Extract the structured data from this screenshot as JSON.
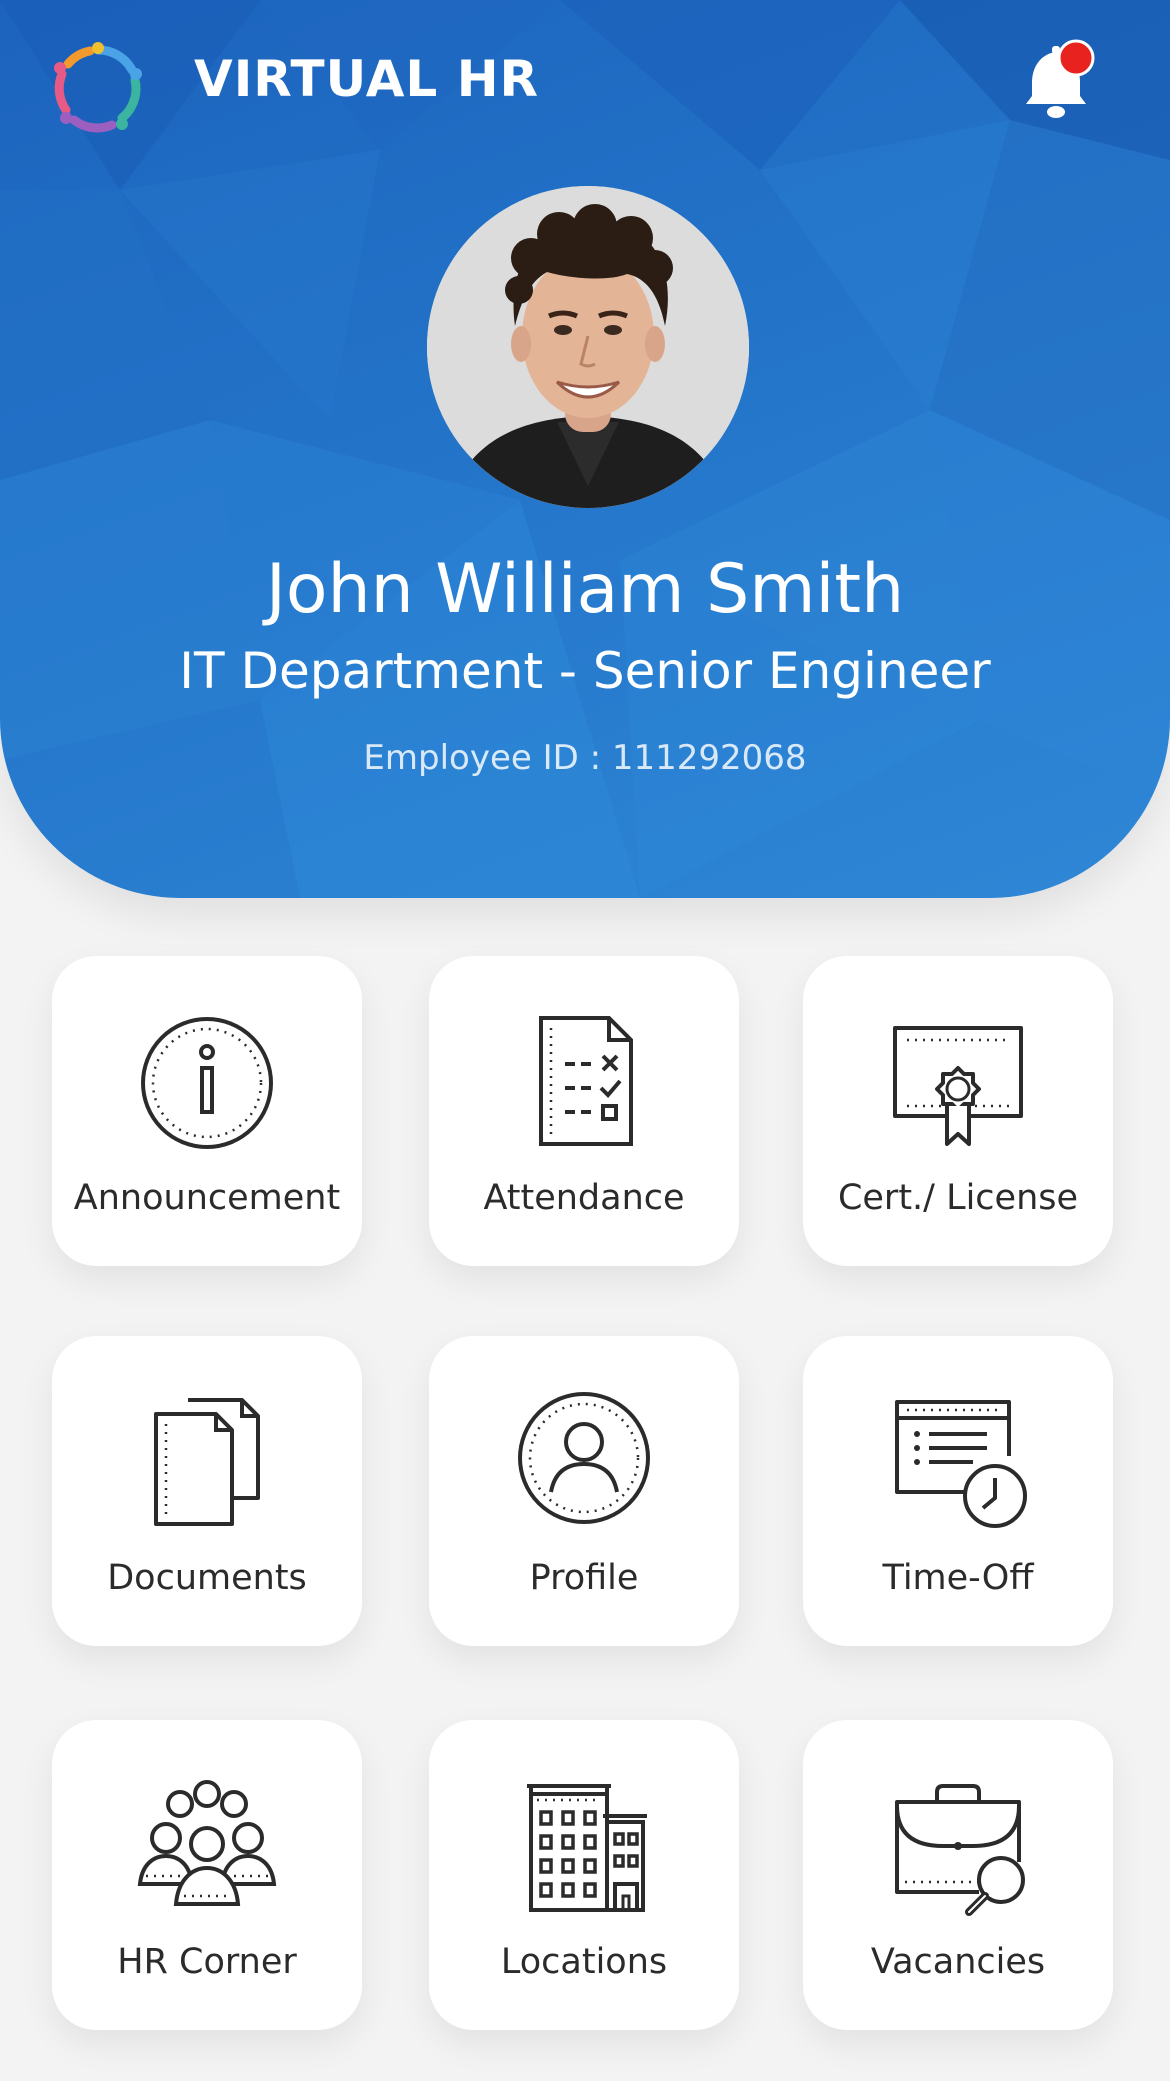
{
  "app": {
    "title": "VIRTUAL HR",
    "logo_icon": "circle-of-people-logo",
    "notification_icon": "bell-icon",
    "notification_badge_color": "#e8231f",
    "brand_color": "#2374c9"
  },
  "employee": {
    "name": "John William Smith",
    "department": "IT Department - Senior Engineer",
    "employee_id": "Employee ID : 111292068"
  },
  "menu": [
    {
      "label": "Announcement",
      "icon": "info-icon"
    },
    {
      "label": "Attendance",
      "icon": "checklist-document-icon"
    },
    {
      "label": "Cert./ License",
      "icon": "certificate-icon"
    },
    {
      "label": "Documents",
      "icon": "documents-icon"
    },
    {
      "label": "Profile",
      "icon": "user-profile-icon"
    },
    {
      "label": "Time-Off",
      "icon": "calendar-clock-icon"
    },
    {
      "label": "HR Corner",
      "icon": "team-icon"
    },
    {
      "label": "Locations",
      "icon": "buildings-icon"
    },
    {
      "label": "Vacancies",
      "icon": "briefcase-search-icon"
    }
  ]
}
